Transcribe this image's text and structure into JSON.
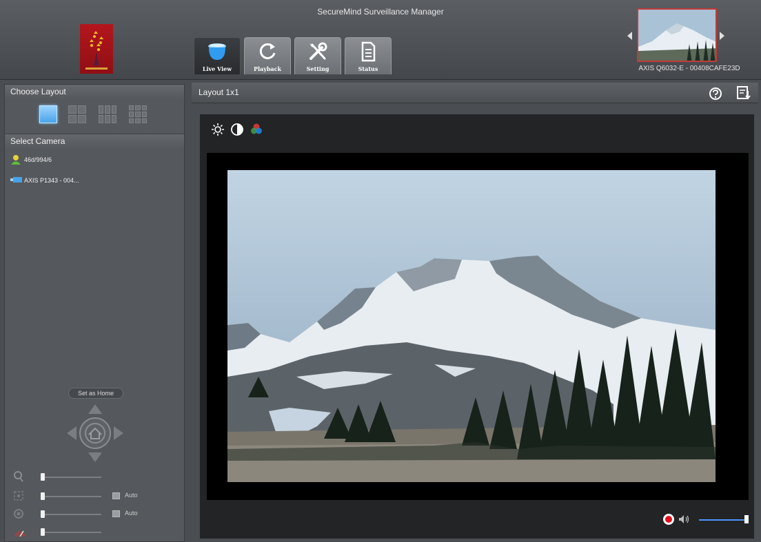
{
  "app": {
    "title": "SecureMind Surveillance Manager"
  },
  "tabs": [
    {
      "label": "Live View",
      "icon": "camera-dome-icon"
    },
    {
      "label": "Playback",
      "icon": "refresh-icon"
    },
    {
      "label": "Setting",
      "icon": "tools-icon"
    },
    {
      "label": "Status",
      "icon": "document-icon"
    }
  ],
  "preview": {
    "camera_name": "AXIS Q6032-E - 00408CAFE23D"
  },
  "sidebar": {
    "layout_heading": "Choose Layout",
    "camera_heading": "Select Camera",
    "cameras": [
      {
        "label": "46d/994/6",
        "icon": "user-camera-icon"
      },
      {
        "label": "AXIS P1343 - 004...",
        "icon": "camera-icon"
      }
    ],
    "ptz": {
      "home_label": "Set as Home"
    },
    "controls": {
      "focus_auto": "Auto",
      "iris_auto": "Auto"
    }
  },
  "main": {
    "layout_title": "Layout 1x1"
  },
  "colors": {
    "accent": "#4aa3ea",
    "record": "#e0101a",
    "logo": "#b4161d"
  }
}
